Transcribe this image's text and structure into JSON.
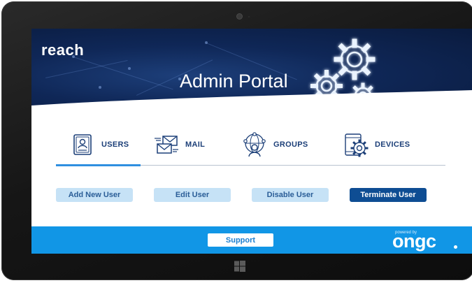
{
  "header": {
    "logo": "reach",
    "title": "Admin Portal"
  },
  "tabs": [
    {
      "label": "USERS",
      "icon": "user-card-icon",
      "active": true
    },
    {
      "label": "MAIL",
      "icon": "mail-icon",
      "active": false
    },
    {
      "label": "GROUPS",
      "icon": "groups-network-icon",
      "active": false
    },
    {
      "label": "DEVICES",
      "icon": "device-settings-icon",
      "active": false
    }
  ],
  "actions": {
    "add": "Add New User",
    "edit": "Edit User",
    "disable": "Disable User",
    "terminate": "Terminate User"
  },
  "footer": {
    "support": "Support",
    "powered_by": "powered by",
    "brand": "ongc"
  },
  "colors": {
    "banner": "#0f2757",
    "footer": "#1196e6",
    "accent": "#2f8fe0",
    "primary_button": "#0e4d93",
    "secondary_button": "#c6e2f6",
    "tab_text": "#1c3f78"
  }
}
